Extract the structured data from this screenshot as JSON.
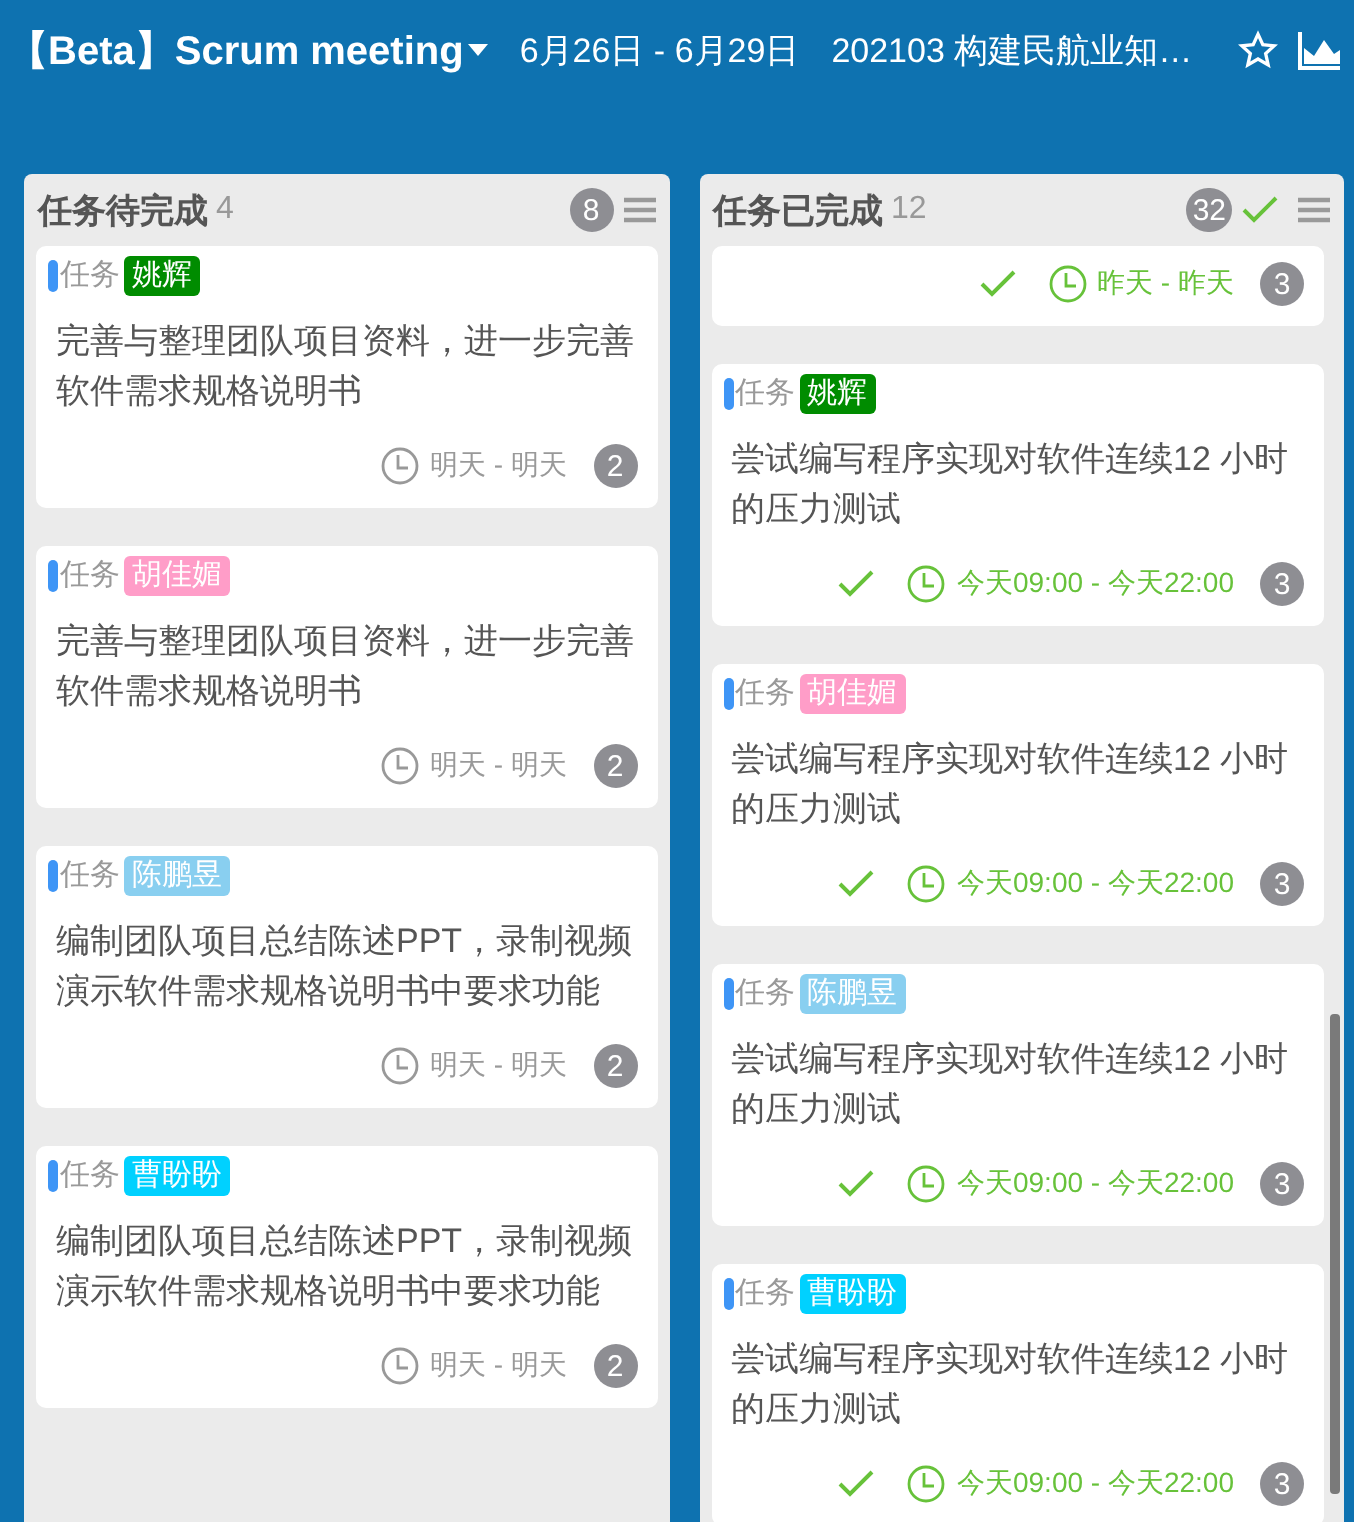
{
  "header": {
    "board_title": "【Beta】Scrum meeting",
    "date_range": "6月26日 - 6月29日",
    "project": "202103 构建民航业知…"
  },
  "columns": [
    {
      "title": "任务待完成",
      "count": "4",
      "badge": "8",
      "show_check": false,
      "cards": [
        {
          "kind": "full",
          "type_label": "任务",
          "assignee": "姚辉",
          "color": "#008c00",
          "text": "完善与整理团队项目资料，进一步完善软件需求规格说明书",
          "done": false,
          "time": "明天 - 明天",
          "badge": "2"
        },
        {
          "kind": "full",
          "type_label": "任务",
          "assignee": "胡佳媚",
          "color": "#ff9dc8",
          "text": "完善与整理团队项目资料，进一步完善软件需求规格说明书",
          "done": false,
          "time": "明天 - 明天",
          "badge": "2"
        },
        {
          "kind": "full",
          "type_label": "任务",
          "assignee": "陈鹏昱",
          "color": "#89cff0",
          "text": "编制团队项目总结陈述PPT，录制视频演示软件需求规格说明书中要求功能",
          "done": false,
          "time": "明天 - 明天",
          "badge": "2"
        },
        {
          "kind": "full",
          "type_label": "任务",
          "assignee": "曹盼盼",
          "color": "#00d1ff",
          "text": "编制团队项目总结陈述PPT，录制视频演示软件需求规格说明书中要求功能",
          "done": false,
          "time": "明天 - 明天",
          "badge": "2"
        }
      ]
    },
    {
      "title": "任务已完成",
      "count": "12",
      "badge": "32",
      "show_check": true,
      "cards": [
        {
          "kind": "partial",
          "done": true,
          "time": "昨天 - 昨天",
          "badge": "3"
        },
        {
          "kind": "full",
          "type_label": "任务",
          "assignee": "姚辉",
          "color": "#008c00",
          "text": "尝试编写程序实现对软件连续12 小时的压力测试",
          "done": true,
          "time": "今天09:00 - 今天22:00",
          "badge": "3"
        },
        {
          "kind": "full",
          "type_label": "任务",
          "assignee": "胡佳媚",
          "color": "#ff9dc8",
          "text": "尝试编写程序实现对软件连续12 小时的压力测试",
          "done": true,
          "time": "今天09:00 - 今天22:00",
          "badge": "3"
        },
        {
          "kind": "full",
          "type_label": "任务",
          "assignee": "陈鹏昱",
          "color": "#89cff0",
          "text": "尝试编写程序实现对软件连续12 小时的压力测试",
          "done": true,
          "time": "今天09:00 - 今天22:00",
          "badge": "3"
        },
        {
          "kind": "full",
          "type_label": "任务",
          "assignee": "曹盼盼",
          "color": "#00d1ff",
          "text": "尝试编写程序实现对软件连续12 小时的压力测试",
          "done": true,
          "time": "今天09:00 - 今天22:00",
          "badge": "3"
        }
      ]
    }
  ]
}
